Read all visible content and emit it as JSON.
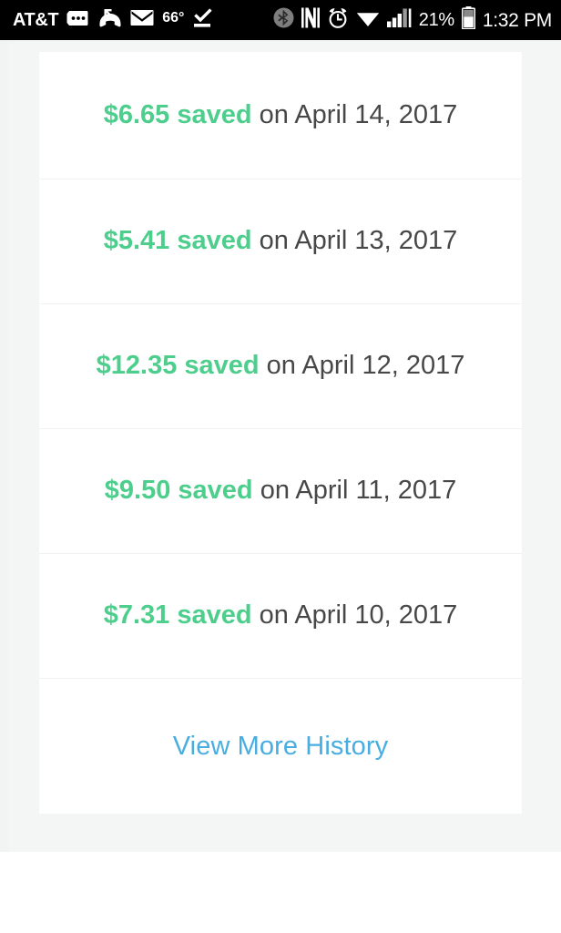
{
  "status_bar": {
    "carrier": "AT&T",
    "temperature": "66°",
    "battery_percent": "21%",
    "time": "1:32 PM",
    "left_icons": [
      "sms-message-icon",
      "missed-call-icon",
      "email-envelope-icon",
      "task-complete-icon"
    ],
    "right_icons": [
      "bluetooth-icon",
      "nfc-icon",
      "alarm-clock-icon",
      "wifi-icon",
      "cellular-signal-icon",
      "battery-icon"
    ]
  },
  "history_card": {
    "rows": [
      {
        "amount": "$6.65 saved",
        "date": " on April 14, 2017"
      },
      {
        "amount": "$5.41 saved",
        "date": " on April 13, 2017"
      },
      {
        "amount": "$12.35 saved",
        "date": " on April 12, 2017"
      },
      {
        "amount": "$9.50 saved",
        "date": " on April 11, 2017"
      },
      {
        "amount": "$7.31 saved",
        "date": " on April 10, 2017"
      }
    ],
    "view_more_label": "View More History"
  },
  "colors": {
    "saved_green": "#4ece8c",
    "link_blue": "#48ade0",
    "date_text": "#474747",
    "page_background": "#f4f5f5",
    "card_background": "#ffffff",
    "divider": "#f0f1f1",
    "status_bar_background": "#000000"
  }
}
